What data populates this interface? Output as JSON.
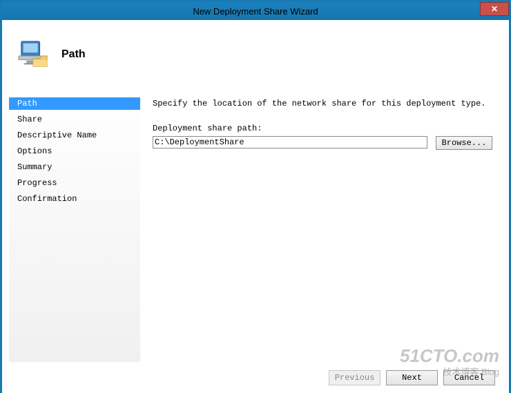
{
  "window": {
    "title": "New Deployment Share Wizard",
    "close_tooltip": "Close",
    "close_glyph": "✕"
  },
  "header": {
    "title": "Path"
  },
  "sidebar": {
    "items": [
      {
        "label": "Path",
        "selected": true
      },
      {
        "label": "Share",
        "selected": false
      },
      {
        "label": "Descriptive Name",
        "selected": false
      },
      {
        "label": "Options",
        "selected": false
      },
      {
        "label": "Summary",
        "selected": false
      },
      {
        "label": "Progress",
        "selected": false
      },
      {
        "label": "Confirmation",
        "selected": false
      }
    ]
  },
  "main": {
    "instruction": "Specify the location of the network share for this deployment type.",
    "field_label": "Deployment share path:",
    "path_value": "C:\\DeploymentShare",
    "browse_label": "Browse..."
  },
  "footer": {
    "previous_label": "Previous",
    "next_label": "Next",
    "cancel_label": "Cancel"
  },
  "watermark": {
    "main": "51CTO.com",
    "sub": "技术博客  Blog"
  }
}
